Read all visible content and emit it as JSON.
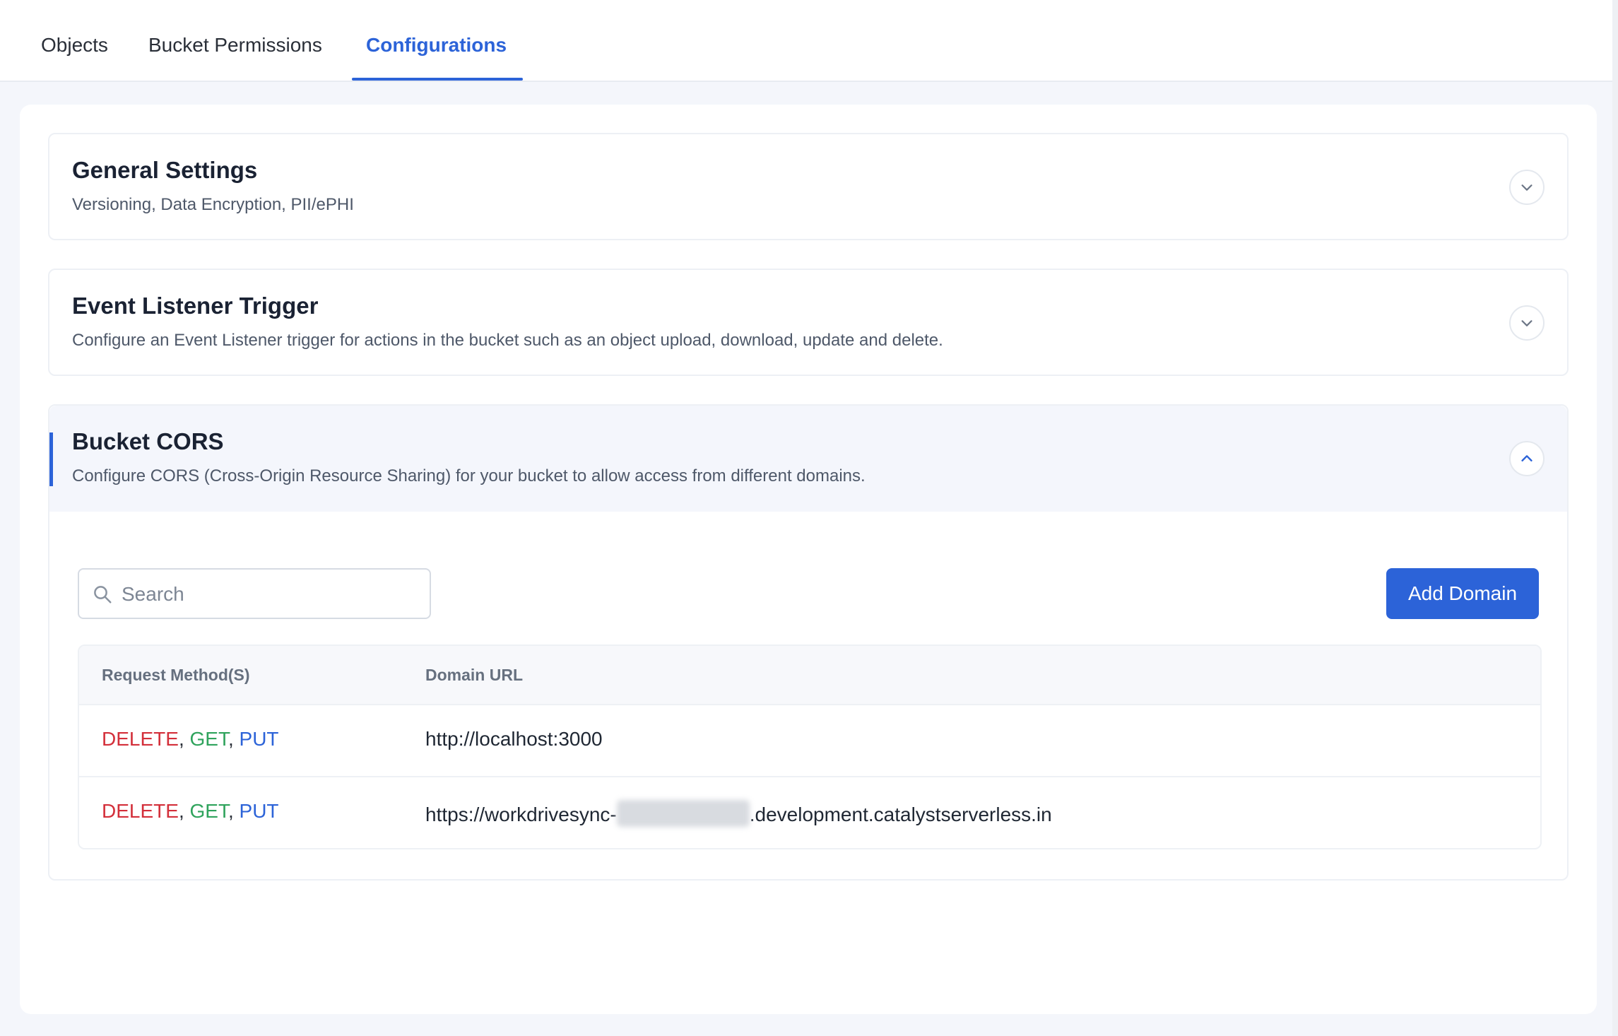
{
  "tabs": [
    {
      "label": "Objects"
    },
    {
      "label": "Bucket Permissions"
    },
    {
      "label": "Configurations"
    }
  ],
  "sections": {
    "general": {
      "title": "General Settings",
      "subtitle": "Versioning, Data Encryption, PII/ePHI"
    },
    "event": {
      "title": "Event Listener Trigger",
      "subtitle": "Configure an Event Listener trigger for actions in the bucket such as an object upload, download, update and delete."
    },
    "cors": {
      "title": "Bucket CORS",
      "subtitle": "Configure CORS (Cross-Origin Resource Sharing) for your bucket to allow access from different domains.",
      "search_placeholder": "Search",
      "add_label": "Add Domain",
      "columns": [
        "Request Method(S)",
        "Domain URL"
      ],
      "rows": [
        {
          "methods": [
            "DELETE",
            "GET",
            "PUT"
          ],
          "url_prefix": "http://localhost:3000",
          "url_suffix": ""
        },
        {
          "methods": [
            "DELETE",
            "GET",
            "PUT"
          ],
          "url_prefix": "https://workdrivesync-",
          "url_suffix": ".development.catalystserverless.in"
        }
      ]
    }
  },
  "colors": {
    "accent": "#2c63d8",
    "delete": "#d32f3a",
    "get": "#2fa35c",
    "put": "#2c63d8"
  },
  "icons": {
    "collapsed": "chevron-down-icon",
    "expanded": "chevron-up-icon",
    "search": "search-icon"
  }
}
